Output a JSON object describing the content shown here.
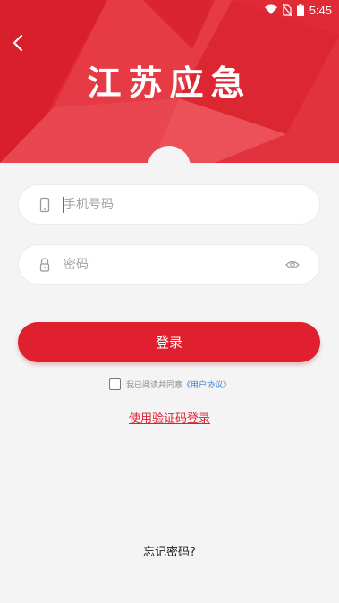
{
  "status_bar": {
    "time": "5:45"
  },
  "header": {
    "title": "江苏应急",
    "accent_color": "#e02a36"
  },
  "form": {
    "phone_placeholder": "手机号码",
    "password_placeholder": "密码",
    "login_label": "登录",
    "agreement_text": "我已阅读并同意",
    "agreement_link": "《用户协议》",
    "sms_login_label": "使用验证码登录",
    "forgot_label": "忘记密码?"
  },
  "icons": {
    "back": "chevron-left-icon",
    "phone": "phone-icon",
    "lock": "lock-icon",
    "eye": "eye-icon",
    "wifi": "wifi-icon",
    "no_sim": "no-sim-icon",
    "battery": "battery-icon"
  }
}
